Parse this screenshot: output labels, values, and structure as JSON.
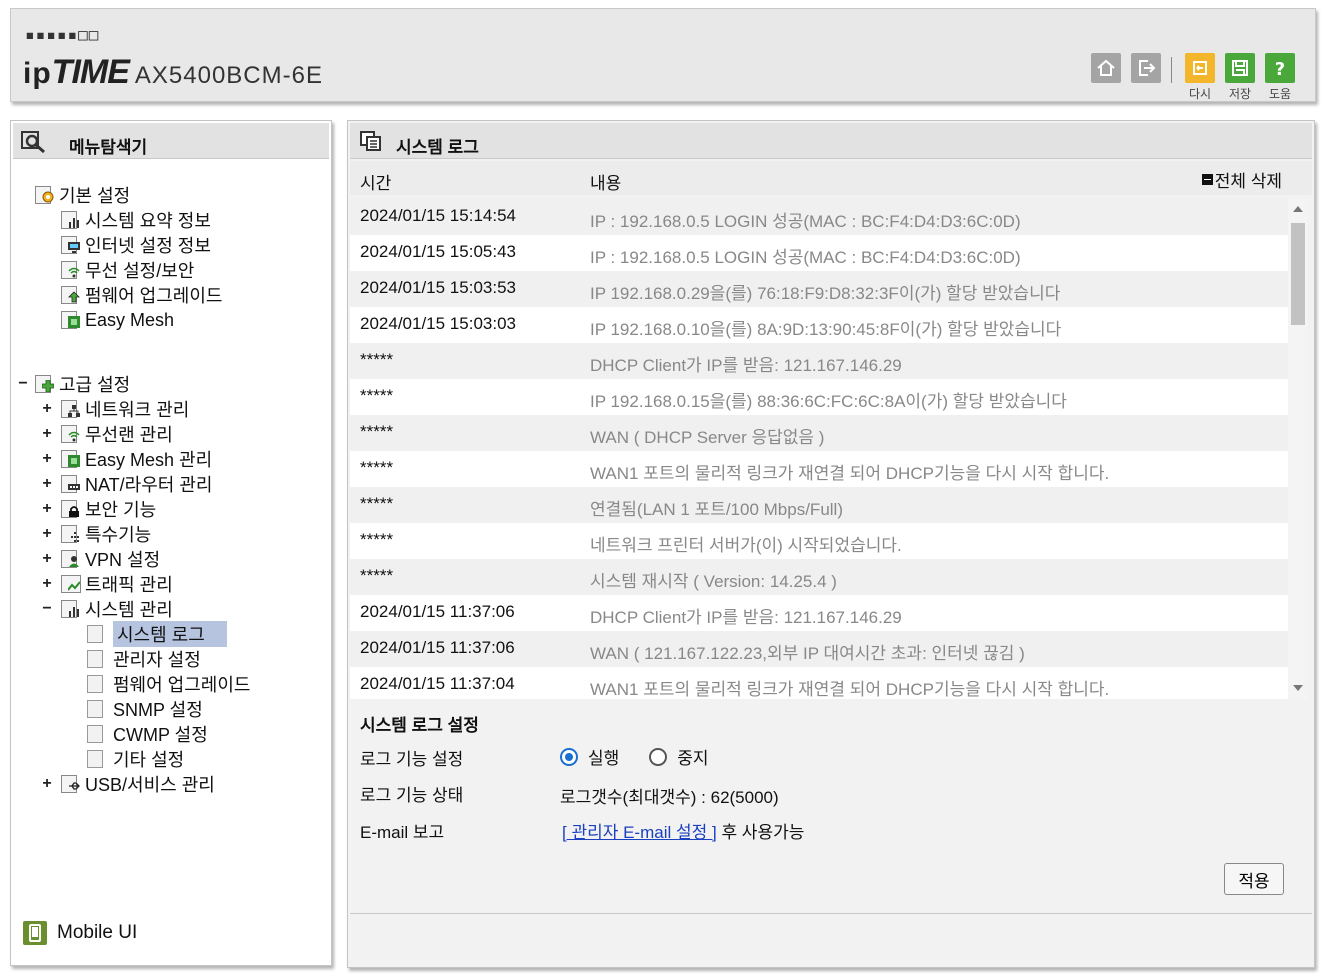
{
  "header": {
    "brand_dots": "▪▪▪▪▪□□",
    "brand_ip": "ip",
    "brand_time": "TIME",
    "model": "AX5400BCM-6E",
    "buttons": {
      "home_icon": "home-icon",
      "logout_icon": "logout-icon",
      "reload_label": "다시",
      "save_label": "저장",
      "help_label": "도움"
    }
  },
  "left": {
    "title": "메뉴탐색기",
    "basic": {
      "label": "기본 설정",
      "items": [
        "시스템 요약 정보",
        "인터넷 설정 정보",
        "무선 설정/보안",
        "펌웨어 업그레이드",
        "Easy Mesh"
      ]
    },
    "advanced": {
      "label": "고급 설정",
      "toggle": "−",
      "items": [
        {
          "toggle": "+",
          "label": "네트워크 관리"
        },
        {
          "toggle": "+",
          "label": "무선랜 관리"
        },
        {
          "toggle": "+",
          "label": "Easy Mesh 관리"
        },
        {
          "toggle": "+",
          "label": "NAT/라우터 관리"
        },
        {
          "toggle": "+",
          "label": "보안 기능"
        },
        {
          "toggle": "+",
          "label": "특수기능"
        },
        {
          "toggle": "+",
          "label": "VPN 설정"
        },
        {
          "toggle": "+",
          "label": "트래픽 관리"
        },
        {
          "toggle": "−",
          "label": "시스템 관리"
        }
      ],
      "system_children": [
        "시스템 로그",
        "관리자 설정",
        "펌웨어 업그레이드",
        "SNMP 설정",
        "CWMP 설정",
        "기타 설정"
      ],
      "usb": {
        "toggle": "+",
        "label": "USB/서비스 관리"
      }
    },
    "mobile_ui": "Mobile UI"
  },
  "right": {
    "title": "시스템 로그",
    "col_time": "시간",
    "col_content": "내용",
    "delete_all": "전체 삭제",
    "logs": [
      {
        "time": "2024/01/15 15:14:54",
        "msg": "IP : 192.168.0.5 LOGIN 성공(MAC : BC:F4:D4:D3:6C:0D)"
      },
      {
        "time": "2024/01/15 15:05:43",
        "msg": "IP : 192.168.0.5 LOGIN 성공(MAC : BC:F4:D4:D3:6C:0D)"
      },
      {
        "time": "2024/01/15 15:03:53",
        "msg": "IP 192.168.0.29을(를) 76:18:F9:D8:32:3F이(가) 할당 받았습니다"
      },
      {
        "time": "2024/01/15 15:03:03",
        "msg": "IP 192.168.0.10을(를) 8A:9D:13:90:45:8F이(가) 할당 받았습니다"
      },
      {
        "time": "*****",
        "msg": "DHCP Client가 IP를 받음: 121.167.146.29"
      },
      {
        "time": "*****",
        "msg": "IP 192.168.0.15을(를) 88:36:6C:FC:6C:8A이(가) 할당 받았습니다"
      },
      {
        "time": "*****",
        "msg": "WAN ( DHCP Server 응답없음 )"
      },
      {
        "time": "*****",
        "msg": "WAN1 포트의 물리적 링크가 재연결 되어 DHCP기능을 다시 시작 합니다."
      },
      {
        "time": "*****",
        "msg": "연결됨(LAN 1 포트/100 Mbps/Full)"
      },
      {
        "time": "*****",
        "msg": "네트워크 프린터 서버가(이) 시작되었습니다."
      },
      {
        "time": "*****",
        "msg": "시스템 재시작 ( Version: 14.25.4 )"
      },
      {
        "time": "2024/01/15 11:37:06",
        "msg": "DHCP Client가 IP를 받음: 121.167.146.29"
      },
      {
        "time": "2024/01/15 11:37:06",
        "msg": "WAN ( 121.167.122.23,외부 IP 대여시간 초과: 인터넷 끊김 )"
      },
      {
        "time": "2024/01/15 11:37:04",
        "msg": "WAN1 포트의 물리적 링크가 재연결 되어 DHCP기능을 다시 시작 합니다."
      }
    ],
    "settings": {
      "title": "시스템 로그 설정",
      "log_func_label": "로그 기능 설정",
      "opt_run": "실행",
      "opt_stop": "중지",
      "log_status_label": "로그 기능 상태",
      "log_status_value": "로그갯수(최대갯수) : 62(5000)",
      "email_label": "E-mail 보고",
      "email_link": "[ 관리자 E-mail 설정 ]",
      "email_suffix": " 후 사용가능",
      "apply": "적용"
    }
  }
}
